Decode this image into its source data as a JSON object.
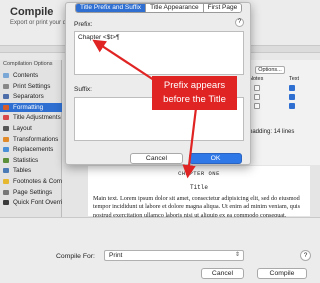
{
  "window": {
    "title": "Compile",
    "subtitle": "Export or print your draft"
  },
  "sidebar": {
    "header": "Compilation Options",
    "items": [
      {
        "label": "Contents",
        "icon": "contents-icon",
        "color": "#7aa7d6"
      },
      {
        "label": "Print Settings",
        "icon": "print-icon",
        "color": "#888888"
      },
      {
        "label": "Separators",
        "icon": "separators-icon",
        "color": "#4d6ea8"
      },
      {
        "label": "Formatting",
        "icon": "formatting-icon",
        "color": "#d85b2a",
        "selected": true
      },
      {
        "label": "Title Adjustments",
        "icon": "title-adjust-icon",
        "color": "#d84a4a"
      },
      {
        "label": "Layout",
        "icon": "layout-icon",
        "color": "#555555"
      },
      {
        "label": "Transformations",
        "icon": "transform-icon",
        "color": "#e08a2a"
      },
      {
        "label": "Replacements",
        "icon": "replace-icon",
        "color": "#4a90d9"
      },
      {
        "label": "Statistics",
        "icon": "stats-icon",
        "color": "#5c8f3a"
      },
      {
        "label": "Tables",
        "icon": "tables-icon",
        "color": "#4a7ab5"
      },
      {
        "label": "Footnotes & Comments",
        "icon": "footnotes-icon",
        "color": "#e6b830"
      },
      {
        "label": "Page Settings",
        "icon": "page-settings-icon",
        "color": "#777777"
      },
      {
        "label": "Quick Font Override",
        "icon": "font-override-icon",
        "color": "#3a3a3a"
      }
    ]
  },
  "right_panel": {
    "options_label": "Options...",
    "notes_header": "Notes",
    "text_header": "Text",
    "padding_label": "e padding: 14 lines"
  },
  "dialog": {
    "tabs": [
      "Title Prefix and Suffix",
      "Title Appearance",
      "First Page"
    ],
    "active_tab": 0,
    "prefix_label": "Prefix:",
    "prefix_value": "Chapter <$t>¶",
    "suffix_label": "Suffix:",
    "help": "?",
    "cancel_label": "Cancel",
    "ok_label": "OK"
  },
  "callout": {
    "line1": "Prefix appears",
    "line2": "before the Title",
    "color": "#e02424"
  },
  "preview": {
    "chapter_heading": "CHAPTER ONE",
    "title_heading": "Title",
    "body": "Main text. Lorem ipsum dolor sit amet, consectetur adipisicing elit, sed do eiusmod tempor incididunt ut labore et dolore magna aliqua. Ut enim ad minim veniam, quis nostrud exercitation ullamco laboris nisi ut aliquip ex ea commodo consequat."
  },
  "bottom": {
    "compile_for_label": "Compile For:",
    "compile_for_value": "Print",
    "help": "?",
    "cancel_label": "Cancel",
    "compile_label": "Compile"
  }
}
